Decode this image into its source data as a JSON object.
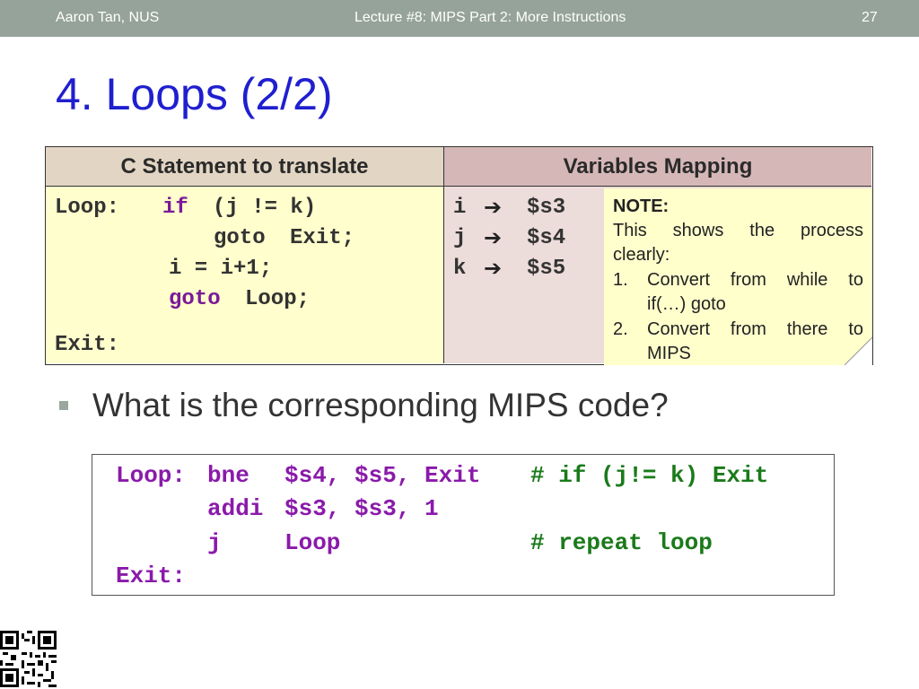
{
  "header": {
    "author": "Aaron Tan, NUS",
    "lecture": "Lecture #8: MIPS Part 2: More Instructions",
    "page_number": "27"
  },
  "title": "4. Loops (2/2)",
  "table": {
    "col1_header": "C Statement to translate",
    "col2_header": "Variables Mapping",
    "c_code": {
      "loop_label": "Loop:",
      "if_kw": "if",
      "if_cond": "(j != k)",
      "goto1_kw": "goto",
      "goto1_target": "Exit;",
      "assign": "i = i+1;",
      "goto2_kw": "goto",
      "goto2_target": "Loop;",
      "exit_label": "Exit:"
    },
    "mapping": [
      {
        "var": "i",
        "reg": "$s3"
      },
      {
        "var": "j",
        "reg": "$s4"
      },
      {
        "var": "k",
        "reg": "$s5"
      }
    ]
  },
  "note": {
    "title": "NOTE:",
    "line1": "This shows the process",
    "line2": "clearly:",
    "item1_idx": "1.",
    "item1_a": "Convert from while to",
    "item1_b": "if(…) goto",
    "item2_idx": "2.",
    "item2_a": "Convert from there to",
    "item2_b": "MIPS"
  },
  "question": "What is the corresponding MIPS code?",
  "mips": {
    "l1_label": "Loop:",
    "l1_instr": "bne",
    "l1_args": "$s4, $s5, Exit",
    "l1_comment": "# if (j!= k) Exit",
    "l2_instr": "addi",
    "l2_args": "$s3, $s3, 1",
    "l3_instr": "j",
    "l3_args": "Loop",
    "l3_comment": "# repeat loop",
    "l4_label": "Exit:"
  },
  "colors": {
    "header_bg": "#96a39a",
    "title": "#1f1fd0",
    "keyword": "#7a1a9a",
    "comment": "#1a7a1a"
  }
}
